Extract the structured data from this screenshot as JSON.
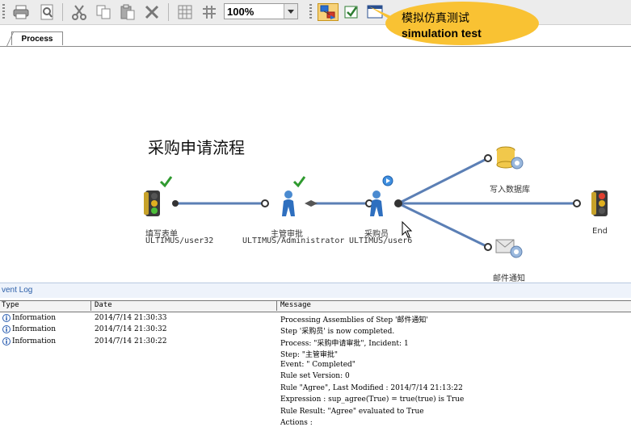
{
  "toolbar": {
    "zoom_value": "100%",
    "icons": [
      "print-icon",
      "print-preview-icon",
      "cut-icon",
      "copy-icon",
      "paste-icon",
      "delete-icon",
      "grid-icon",
      "layout-icon",
      "simulate-icon",
      "validate-icon",
      "window-icon"
    ]
  },
  "callout": {
    "line1": "模拟仿真测试",
    "line2": "simulation  test"
  },
  "tabs": [
    {
      "label": "Process"
    }
  ],
  "process": {
    "title": "采购申请流程",
    "nodes": [
      {
        "label": "填写表单",
        "sub": "ULTIMUS/user32"
      },
      {
        "label": "主管审批",
        "sub": "ULTIMUS/Administrator"
      },
      {
        "label": "采购员",
        "sub": "ULTIMUS/user6"
      },
      {
        "label": "写入数据库",
        "sub": ""
      },
      {
        "label": "End",
        "sub": ""
      },
      {
        "label": "邮件通知",
        "sub": ""
      }
    ]
  },
  "event_log": {
    "title": "vent Log",
    "columns": [
      "Type",
      "Date",
      "Message"
    ],
    "rows": [
      {
        "type": "Information",
        "date": "2014/7/14 21:30:33",
        "message": "Processing Assemblies of Step '邮件通知'"
      },
      {
        "type": "Information",
        "date": "2014/7/14 21:30:32",
        "message": "Step '采购员' is now completed."
      },
      {
        "type": "Information",
        "date": "2014/7/14 21:30:22",
        "message": "Process: \"采购申请审批\", Incident: 1"
      }
    ],
    "extra_lines": [
      "Step: \"主管审批\"",
      "Event: \" Completed\"",
      "Rule set Version:  0",
      "Rule \"Agree\", Last Modified :  2014/7/14 21:13:22",
      "Expression : sup_agree(True) = true(true) is True",
      "Rule Result: \"Agree\" evaluated to True",
      "Actions :"
    ]
  },
  "colors": {
    "connector": "#5b7fb5",
    "check": "#2f9a2f",
    "accent": "#f9c233"
  }
}
